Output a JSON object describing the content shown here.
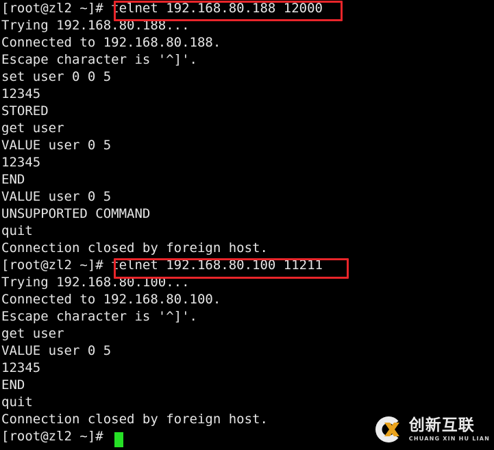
{
  "terminal": {
    "prompt": "[root@zl2 ~]#",
    "hostname": "zl2",
    "user": "root",
    "background_color": "#000000",
    "text_color": "#e6e6e6",
    "cursor_color": "#26e026",
    "annotation_color": "#e8252a",
    "lines": [
      {
        "text": "[root@zl2 ~]# telnet 192.168.80.188 12000"
      },
      {
        "text": "Trying 192.168.80.188..."
      },
      {
        "text": "Connected to 192.168.80.188."
      },
      {
        "text": "Escape character is '^]'."
      },
      {
        "text": "set user 0 0 5"
      },
      {
        "text": "12345"
      },
      {
        "text": "STORED"
      },
      {
        "text": "get user"
      },
      {
        "text": "VALUE user 0 5"
      },
      {
        "text": "12345"
      },
      {
        "text": "END"
      },
      {
        "text": "VALUE user 0 5"
      },
      {
        "text": "UNSUPPORTED COMMAND"
      },
      {
        "text": "quit"
      },
      {
        "text": "Connection closed by foreign host."
      },
      {
        "text": "[root@zl2 ~]# telnet 192.168.80.100 11211"
      },
      {
        "text": "Trying 192.168.80.100..."
      },
      {
        "text": "Connected to 192.168.80.100."
      },
      {
        "text": "Escape character is '^]'."
      },
      {
        "text": "get user"
      },
      {
        "text": "VALUE user 0 5"
      },
      {
        "text": "12345"
      },
      {
        "text": "END"
      },
      {
        "text": "quit"
      },
      {
        "text": "Connection closed by foreign host."
      },
      {
        "text": "[root@zl2 ~]# "
      }
    ],
    "highlights": [
      {
        "label": "telnet 192.168.80.188 12000"
      },
      {
        "label": "telnet 192.168.80.100 11211"
      }
    ]
  },
  "watermark": {
    "logo_icon": "cx-logo-icon",
    "cn_name": "创新互联",
    "pinyin": "CHUANG XIN HU LIAN"
  }
}
